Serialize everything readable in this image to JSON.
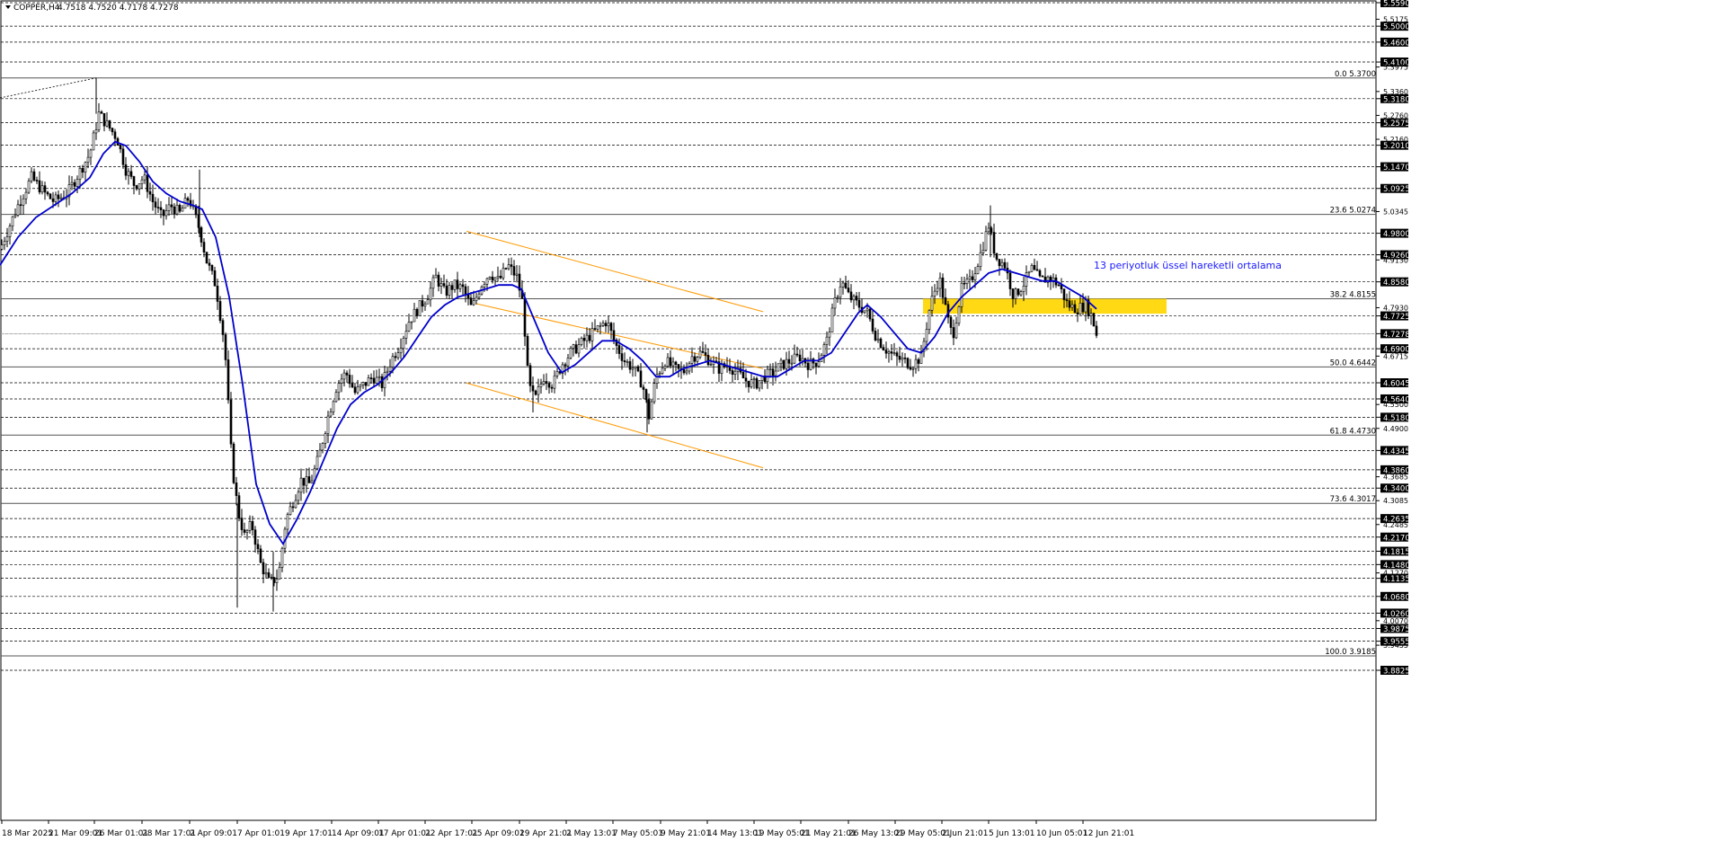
{
  "header": {
    "symbol": "COPPER,H4",
    "ohlc": "4.7518 4.7520 4.7178 4.7278"
  },
  "annotation": {
    "text": "13 periyotluk üssel hareketli ortalama"
  },
  "colors": {
    "ema": "#0000cc",
    "channel": "#ff9900",
    "zone": "#ffd700",
    "candle": "#000000",
    "grid": "#000000"
  },
  "chart_data": {
    "type": "candlestick",
    "symbol": "COPPER",
    "timeframe": "H4",
    "price_range": [
      3.8825,
      5.559
    ],
    "x_ticks": [
      "18 Mar 2025",
      "21 Mar 09:01",
      "26 Mar 01:01",
      "28 Mar 17:01",
      "2 Apr 09:01",
      "7 Apr 01:01",
      "9 Apr 17:01",
      "14 Apr 09:01",
      "17 Apr 01:01",
      "22 Apr 17:01",
      "25 Apr 09:01",
      "29 Apr 21:01",
      "2 May 13:01",
      "7 May 05:01",
      "9 May 21:01",
      "14 May 13:01",
      "19 May 05:01",
      "21 May 21:01",
      "26 May 13:01",
      "29 May 05:01",
      "2 Jun 21:01",
      "5 Jun 13:01",
      "10 Jun 05:01",
      "12 Jun 21:01"
    ],
    "boxed_levels": [
      "5.5590",
      "5.5000",
      "5.4600",
      "5.4100",
      "5.3180",
      "5.2575",
      "5.2010",
      "5.1470",
      "5.0925",
      "4.9800",
      "4.9260",
      "4.8580",
      "4.7725",
      "4.7278",
      "4.6900",
      "4.6045",
      "4.5640",
      "4.5180",
      "4.4345",
      "4.3860",
      "4.3400",
      "4.2635",
      "4.2170",
      "4.1815",
      "4.1480",
      "4.1135",
      "4.0680",
      "4.0260",
      "3.9875",
      "3.9555",
      "3.8825"
    ],
    "small_labels": [
      "5.5175",
      "5.3975",
      "5.3360",
      "5.2760",
      "5.2160",
      "5.0345",
      "4.9130",
      "4.7930",
      "4.6715",
      "4.5500",
      "4.4900",
      "4.3685",
      "4.3085",
      "4.2485",
      "4.1270",
      "4.0070",
      "3.9455"
    ],
    "fibonacci": [
      {
        "label": "0.0 5.3700",
        "price": 5.37
      },
      {
        "label": "23.6 5.0274",
        "price": 5.0274
      },
      {
        "label": "38.2 4.8155",
        "price": 4.8155
      },
      {
        "label": "50.0 4.6442",
        "price": 4.6442
      },
      {
        "label": "61.8 4.4730",
        "price": 4.473
      },
      {
        "label": "73.6 4.3017",
        "price": 4.3017
      },
      {
        "label": "100.0 3.9185",
        "price": 3.9185
      }
    ],
    "price_path": [
      [
        0,
        4.94
      ],
      [
        20,
        5.05
      ],
      [
        35,
        5.12
      ],
      [
        50,
        5.08
      ],
      [
        60,
        5.06
      ],
      [
        75,
        5.08
      ],
      [
        85,
        5.12
      ],
      [
        100,
        5.18
      ],
      [
        110,
        5.28
      ],
      [
        120,
        5.25
      ],
      [
        130,
        5.22
      ],
      [
        140,
        5.14
      ],
      [
        150,
        5.1
      ],
      [
        160,
        5.12
      ],
      [
        170,
        5.06
      ],
      [
        180,
        5.02
      ],
      [
        190,
        5.05
      ],
      [
        200,
        5.03
      ],
      [
        210,
        5.07
      ],
      [
        222,
        4.99
      ],
      [
        230,
        4.91
      ],
      [
        240,
        4.85
      ],
      [
        250,
        4.7
      ],
      [
        258,
        4.4
      ],
      [
        265,
        4.28
      ],
      [
        272,
        4.22
      ],
      [
        280,
        4.25
      ],
      [
        290,
        4.15
      ],
      [
        300,
        4.1
      ],
      [
        310,
        4.12
      ],
      [
        318,
        4.26
      ],
      [
        325,
        4.3
      ],
      [
        335,
        4.36
      ],
      [
        345,
        4.35
      ],
      [
        355,
        4.42
      ],
      [
        365,
        4.52
      ],
      [
        375,
        4.6
      ],
      [
        385,
        4.63
      ],
      [
        395,
        4.58
      ],
      [
        405,
        4.6
      ],
      [
        415,
        4.62
      ],
      [
        425,
        4.6
      ],
      [
        435,
        4.66
      ],
      [
        445,
        4.7
      ],
      [
        455,
        4.76
      ],
      [
        465,
        4.79
      ],
      [
        475,
        4.82
      ],
      [
        485,
        4.87
      ],
      [
        495,
        4.83
      ],
      [
        505,
        4.85
      ],
      [
        515,
        4.84
      ],
      [
        525,
        4.79
      ],
      [
        535,
        4.85
      ],
      [
        545,
        4.88
      ],
      [
        555,
        4.86
      ],
      [
        565,
        4.9
      ],
      [
        575,
        4.87
      ],
      [
        582,
        4.8
      ],
      [
        588,
        4.6
      ],
      [
        595,
        4.56
      ],
      [
        605,
        4.62
      ],
      [
        615,
        4.6
      ],
      [
        625,
        4.65
      ],
      [
        635,
        4.68
      ],
      [
        645,
        4.7
      ],
      [
        655,
        4.72
      ],
      [
        665,
        4.74
      ],
      [
        675,
        4.76
      ],
      [
        685,
        4.7
      ],
      [
        695,
        4.66
      ],
      [
        705,
        4.64
      ],
      [
        715,
        4.6
      ],
      [
        722,
        4.52
      ],
      [
        730,
        4.62
      ],
      [
        740,
        4.66
      ],
      [
        750,
        4.64
      ],
      [
        760,
        4.63
      ],
      [
        770,
        4.67
      ],
      [
        780,
        4.68
      ],
      [
        790,
        4.66
      ],
      [
        800,
        4.64
      ],
      [
        810,
        4.65
      ],
      [
        820,
        4.63
      ],
      [
        830,
        4.61
      ],
      [
        840,
        4.6
      ],
      [
        850,
        4.62
      ],
      [
        860,
        4.63
      ],
      [
        870,
        4.65
      ],
      [
        880,
        4.66
      ],
      [
        890,
        4.67
      ],
      [
        900,
        4.65
      ],
      [
        910,
        4.66
      ],
      [
        920,
        4.71
      ],
      [
        928,
        4.8
      ],
      [
        936,
        4.86
      ],
      [
        945,
        4.82
      ],
      [
        955,
        4.8
      ],
      [
        965,
        4.78
      ],
      [
        975,
        4.72
      ],
      [
        985,
        4.69
      ],
      [
        995,
        4.67
      ],
      [
        1005,
        4.66
      ],
      [
        1015,
        4.65
      ],
      [
        1025,
        4.67
      ],
      [
        1035,
        4.8
      ],
      [
        1045,
        4.87
      ],
      [
        1055,
        4.76
      ],
      [
        1060,
        4.72
      ],
      [
        1070,
        4.84
      ],
      [
        1080,
        4.86
      ],
      [
        1090,
        4.92
      ],
      [
        1100,
        5.0
      ],
      [
        1108,
        4.92
      ],
      [
        1118,
        4.9
      ],
      [
        1128,
        4.82
      ],
      [
        1138,
        4.85
      ],
      [
        1148,
        4.89
      ],
      [
        1158,
        4.86
      ],
      [
        1168,
        4.87
      ],
      [
        1178,
        4.85
      ],
      [
        1188,
        4.8
      ],
      [
        1198,
        4.79
      ],
      [
        1208,
        4.8
      ],
      [
        1215,
        4.77
      ],
      [
        1220,
        4.727
      ]
    ],
    "ema_path": [
      [
        0,
        4.9
      ],
      [
        20,
        4.97
      ],
      [
        40,
        5.02
      ],
      [
        60,
        5.05
      ],
      [
        80,
        5.08
      ],
      [
        100,
        5.12
      ],
      [
        115,
        5.18
      ],
      [
        128,
        5.21
      ],
      [
        140,
        5.2
      ],
      [
        155,
        5.16
      ],
      [
        170,
        5.11
      ],
      [
        185,
        5.08
      ],
      [
        200,
        5.06
      ],
      [
        215,
        5.05
      ],
      [
        225,
        5.04
      ],
      [
        240,
        4.97
      ],
      [
        255,
        4.82
      ],
      [
        270,
        4.6
      ],
      [
        285,
        4.35
      ],
      [
        300,
        4.25
      ],
      [
        315,
        4.2
      ],
      [
        330,
        4.26
      ],
      [
        345,
        4.33
      ],
      [
        360,
        4.41
      ],
      [
        375,
        4.49
      ],
      [
        390,
        4.55
      ],
      [
        405,
        4.58
      ],
      [
        420,
        4.6
      ],
      [
        435,
        4.63
      ],
      [
        450,
        4.67
      ],
      [
        465,
        4.72
      ],
      [
        480,
        4.77
      ],
      [
        495,
        4.8
      ],
      [
        510,
        4.82
      ],
      [
        525,
        4.83
      ],
      [
        540,
        4.84
      ],
      [
        555,
        4.85
      ],
      [
        570,
        4.85
      ],
      [
        580,
        4.84
      ],
      [
        595,
        4.76
      ],
      [
        610,
        4.68
      ],
      [
        625,
        4.63
      ],
      [
        640,
        4.65
      ],
      [
        655,
        4.68
      ],
      [
        670,
        4.71
      ],
      [
        685,
        4.71
      ],
      [
        700,
        4.69
      ],
      [
        715,
        4.66
      ],
      [
        730,
        4.62
      ],
      [
        745,
        4.62
      ],
      [
        760,
        4.64
      ],
      [
        775,
        4.65
      ],
      [
        790,
        4.66
      ],
      [
        805,
        4.65
      ],
      [
        820,
        4.64
      ],
      [
        835,
        4.63
      ],
      [
        850,
        4.62
      ],
      [
        865,
        4.62
      ],
      [
        880,
        4.64
      ],
      [
        895,
        4.66
      ],
      [
        910,
        4.66
      ],
      [
        925,
        4.68
      ],
      [
        940,
        4.73
      ],
      [
        955,
        4.78
      ],
      [
        965,
        4.8
      ],
      [
        980,
        4.77
      ],
      [
        995,
        4.73
      ],
      [
        1010,
        4.69
      ],
      [
        1025,
        4.68
      ],
      [
        1040,
        4.72
      ],
      [
        1055,
        4.78
      ],
      [
        1070,
        4.82
      ],
      [
        1085,
        4.85
      ],
      [
        1100,
        4.88
      ],
      [
        1115,
        4.89
      ],
      [
        1130,
        4.88
      ],
      [
        1145,
        4.87
      ],
      [
        1160,
        4.86
      ],
      [
        1175,
        4.86
      ],
      [
        1190,
        4.84
      ],
      [
        1205,
        4.82
      ],
      [
        1220,
        4.79
      ]
    ],
    "channel_lines": [
      [
        [
          519,
          4.985
        ],
        [
          849,
          4.783
        ]
      ],
      [
        [
          530,
          4.803
        ],
        [
          849,
          4.64
        ]
      ],
      [
        [
          519,
          4.604
        ],
        [
          849,
          4.391
        ]
      ]
    ],
    "zone": {
      "x_start_bar": 1027,
      "x_end_bar": 1298,
      "price_top": 4.8155,
      "price_bottom": 4.778
    },
    "trend_line_topleft": [
      [
        0,
        5.32
      ],
      [
        107,
        5.37
      ]
    ]
  }
}
